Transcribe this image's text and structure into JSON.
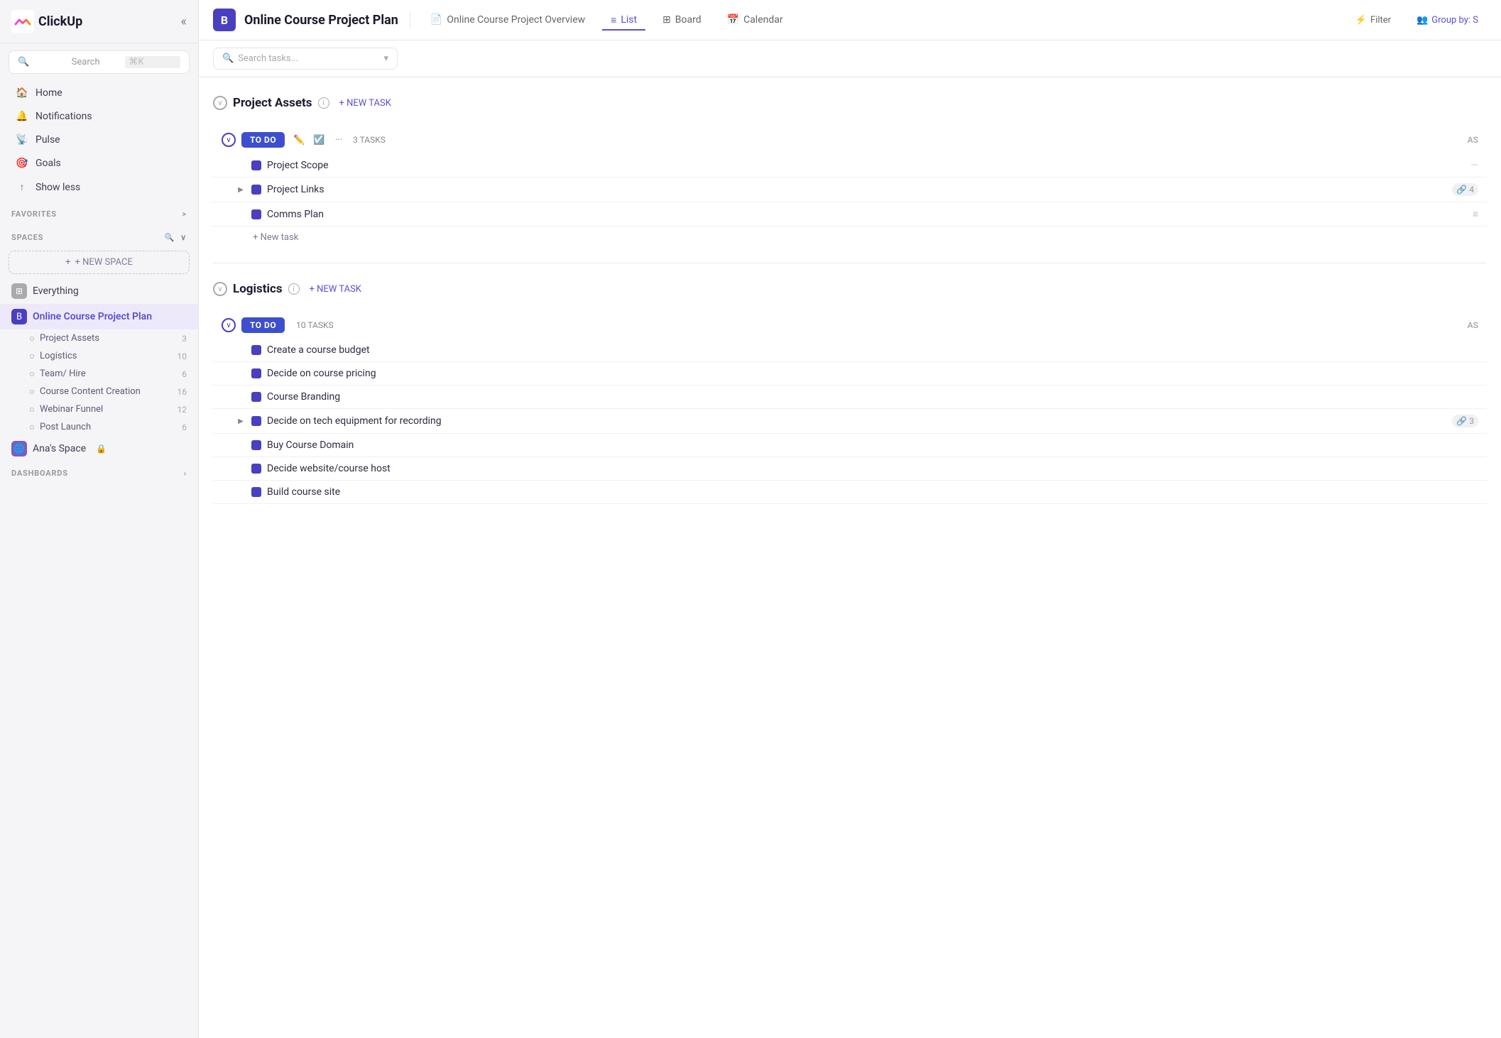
{
  "app": {
    "name": "ClickUp"
  },
  "sidebar": {
    "collapse_label": "«",
    "search": {
      "placeholder": "Search",
      "shortcut": "⌘K"
    },
    "nav_items": [
      {
        "id": "home",
        "label": "Home",
        "icon": "🏠"
      },
      {
        "id": "notifications",
        "label": "Notifications",
        "icon": "🔔"
      },
      {
        "id": "pulse",
        "label": "Pulse",
        "icon": "📡"
      },
      {
        "id": "goals",
        "label": "Goals",
        "icon": "🎯"
      },
      {
        "id": "show-less",
        "label": "Show less",
        "icon": "↑"
      }
    ],
    "favorites_label": "FAVORITES",
    "favorites_expand": ">",
    "spaces_label": "SPACES",
    "new_space_label": "+ NEW SPACE",
    "spaces": [
      {
        "id": "everything",
        "label": "Everything",
        "icon": "⊞",
        "bg": "#aaa",
        "active": false
      },
      {
        "id": "online-course",
        "label": "Online Course Project Plan",
        "icon": "B",
        "bg": "#4a3fc0",
        "active": true
      }
    ],
    "list_items": [
      {
        "label": "Project Assets",
        "count": 3
      },
      {
        "label": "Logistics",
        "count": 10
      },
      {
        "label": "Team/ Hire",
        "count": 6
      },
      {
        "label": "Course Content Creation",
        "count": 16
      },
      {
        "label": "Webinar Funnel",
        "count": 12
      },
      {
        "label": "Post Launch",
        "count": 6
      }
    ],
    "anas_space": {
      "label": "Ana's Space",
      "icon": "🌐",
      "lock": "🔒"
    },
    "dashboards_label": "DASHBOARDS"
  },
  "topbar": {
    "project_icon": "B",
    "project_title": "Online Course Project Plan",
    "nav_items": [
      {
        "id": "overview",
        "label": "Online Course Project Overview",
        "icon": "📄",
        "active": false
      },
      {
        "id": "list",
        "label": "List",
        "icon": "≡",
        "active": true
      },
      {
        "id": "board",
        "label": "Board",
        "icon": "⊞",
        "active": false
      },
      {
        "id": "calendar",
        "label": "Calendar",
        "icon": "📅",
        "active": false
      }
    ],
    "filter_label": "Filter",
    "group_by_label": "Group by: S"
  },
  "toolbar": {
    "search_placeholder": "Search tasks...",
    "dropdown_icon": "▾"
  },
  "content": {
    "groups": [
      {
        "id": "project-assets",
        "title": "Project Assets",
        "new_task_label": "+ NEW TASK",
        "status_groups": [
          {
            "id": "todo-1",
            "badge": "TO DO",
            "task_count_label": "3 TASKS",
            "as_label": "AS",
            "tasks": [
              {
                "id": "task-1",
                "name": "Project Scope",
                "has_expand": false,
                "subtask_count": null,
                "has_dash": true
              },
              {
                "id": "task-2",
                "name": "Project Links",
                "has_expand": true,
                "subtask_count": 4,
                "has_dash": false
              },
              {
                "id": "task-3",
                "name": "Comms Plan",
                "has_expand": false,
                "subtask_count": null,
                "has_lines": true
              }
            ],
            "add_task_label": "+ New task"
          }
        ]
      },
      {
        "id": "logistics",
        "title": "Logistics",
        "new_task_label": "+ NEW TASK",
        "status_groups": [
          {
            "id": "todo-2",
            "badge": "TO DO",
            "task_count_label": "10 TASKS",
            "as_label": "AS",
            "tasks": [
              {
                "id": "task-4",
                "name": "Create a course budget",
                "has_expand": false,
                "subtask_count": null
              },
              {
                "id": "task-5",
                "name": "Decide on course pricing",
                "has_expand": false,
                "subtask_count": null
              },
              {
                "id": "task-6",
                "name": "Course Branding",
                "has_expand": false,
                "subtask_count": null
              },
              {
                "id": "task-7",
                "name": "Decide on tech equipment for recording",
                "has_expand": true,
                "subtask_count": 3
              },
              {
                "id": "task-8",
                "name": "Buy Course Domain",
                "has_expand": false,
                "subtask_count": null
              },
              {
                "id": "task-9",
                "name": "Decide website/course host",
                "has_expand": false,
                "subtask_count": null
              },
              {
                "id": "task-10",
                "name": "Build course site",
                "has_expand": false,
                "subtask_count": null
              }
            ]
          }
        ]
      }
    ]
  }
}
